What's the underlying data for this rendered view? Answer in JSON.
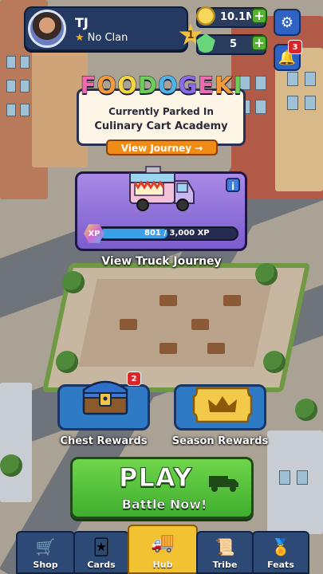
{
  "profile": {
    "name": "TJ",
    "clan": "No Clan",
    "rank": "1"
  },
  "resources": {
    "coins": "10.1M",
    "gems": "5"
  },
  "notifications": {
    "count": "3"
  },
  "game": {
    "logo": "FOODOGEKI",
    "parked_line1": "Currently Parked In",
    "parked_line2": "Culinary Cart Academy",
    "view_journey": "View Journey →"
  },
  "truck": {
    "xp_label": "XP",
    "xp_text": "801 / 3,000 XP",
    "xp_progress": 0.267,
    "view_truck_journey": "View Truck Journey"
  },
  "rewards": {
    "chest_label": "Chest Rewards",
    "chest_badge": "2",
    "season_label": "Season Rewards"
  },
  "play": {
    "title": "PLAY",
    "subtitle": "Battle Now!"
  },
  "nav": {
    "tabs": [
      {
        "label": "Shop",
        "icon": "cart-icon"
      },
      {
        "label": "Cards",
        "icon": "cards-icon"
      },
      {
        "label": "Hub",
        "icon": "food-truck-icon"
      },
      {
        "label": "Tribe",
        "icon": "scroll-icon"
      },
      {
        "label": "Feats",
        "icon": "medal-icon"
      }
    ],
    "active": "Hub"
  },
  "colors": {
    "play_green": "#4fbf38",
    "accent_orange": "#f08b16",
    "active_tab_gold": "#f3c233",
    "panel_blue": "#2c4a75"
  }
}
